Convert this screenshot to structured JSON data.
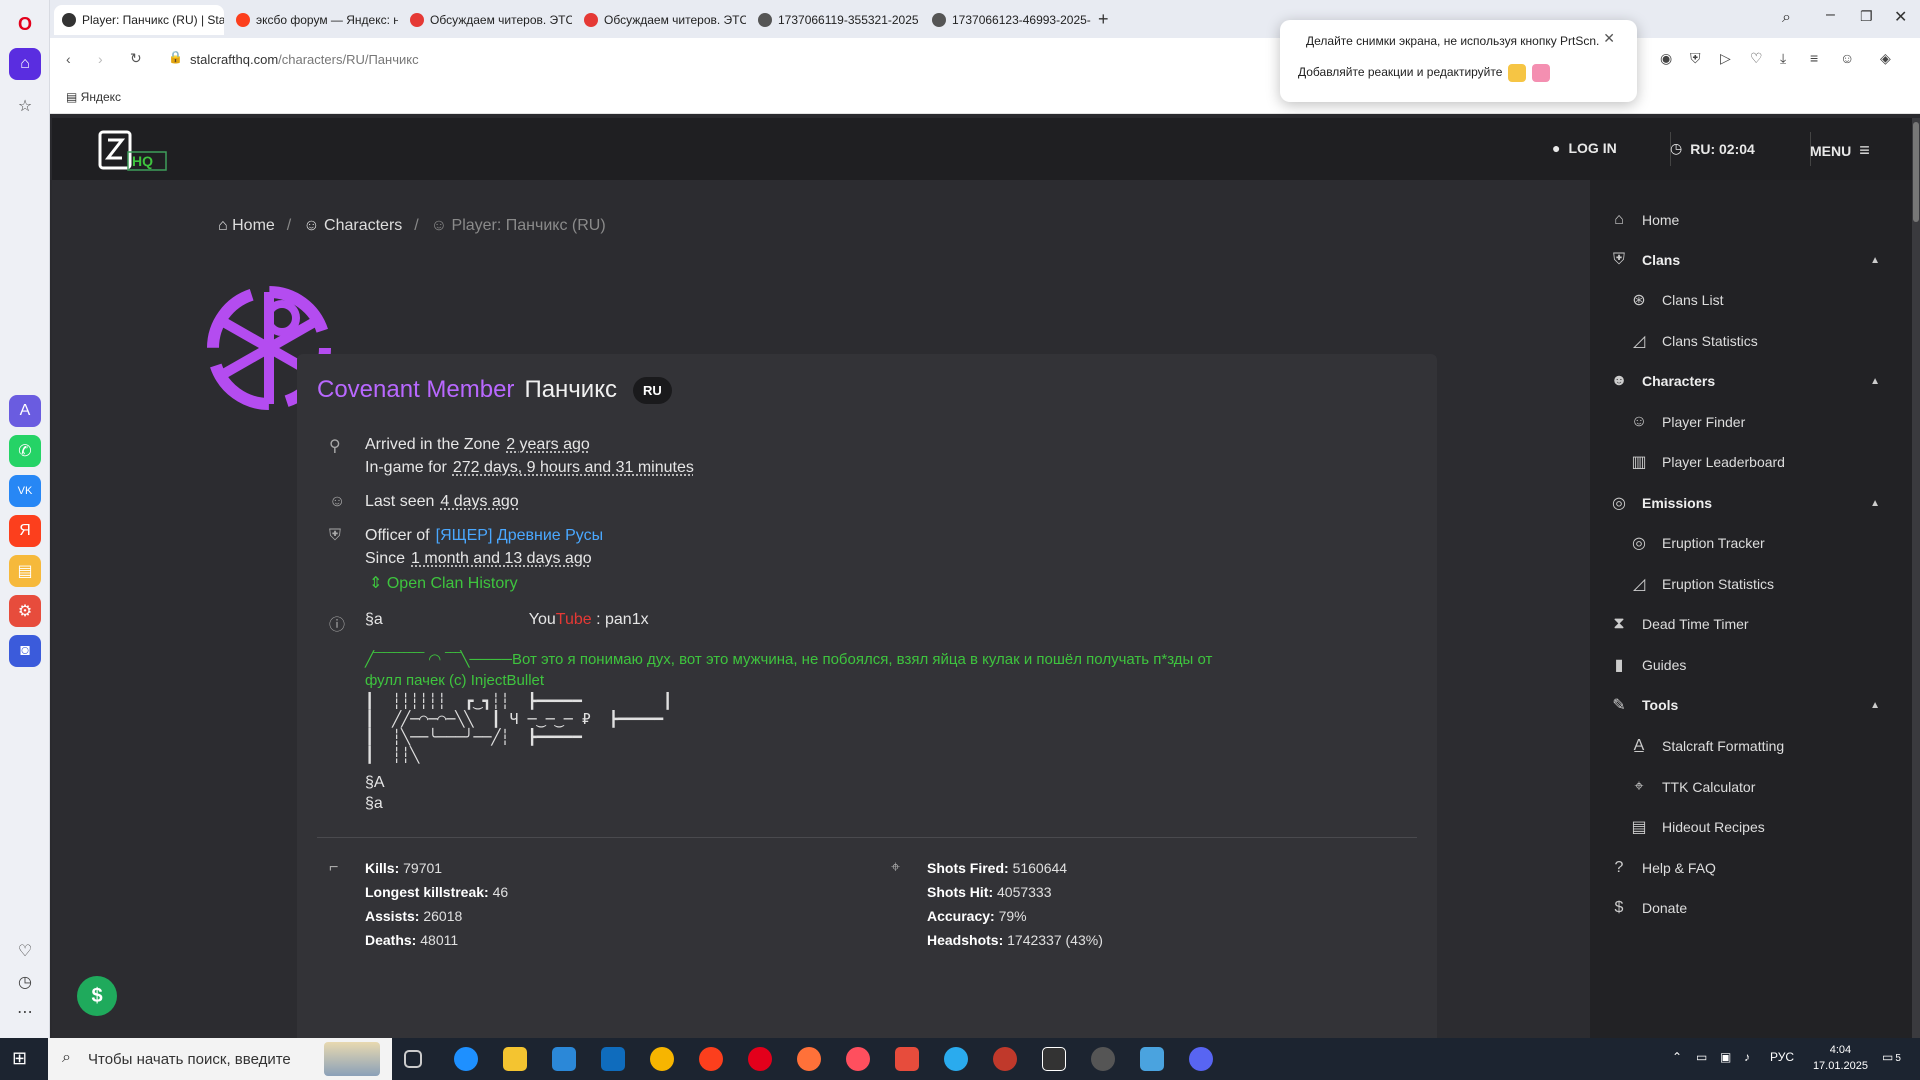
{
  "browser": {
    "tabs": [
      {
        "title": "Player: Панчикс (RU) | Sta",
        "color": "#333333"
      },
      {
        "title": "эксбо форум — Яндекс: н",
        "color": "#fc3f1d"
      },
      {
        "title": "Обсуждаем читеров. ЭТС",
        "color": "#e53935"
      },
      {
        "title": "Обсуждаем читеров. ЭТС",
        "color": "#e53935"
      },
      {
        "title": "1737066119-355321-2025",
        "color": "#555555"
      },
      {
        "title": "1737066123-46993-2025-",
        "color": "#555555"
      }
    ],
    "url_host": "stalcrafthq.com",
    "url_path": "/characters/RU/Панчикс",
    "bookmark": "Яндекс"
  },
  "popup": {
    "line1": "Делайте снимки экрана, не используя кнопку PrtScn.",
    "line2": "Добавляйте реакции и редактируйте"
  },
  "header": {
    "login": "LOG IN",
    "time": "RU: 02:04",
    "menu": "MENU"
  },
  "breadcrumb": {
    "home": "Home",
    "characters": "Characters",
    "current": "Player: Панчикс (RU)"
  },
  "player": {
    "rank": "Covenant Member",
    "name": "Панчикс",
    "region": "RU",
    "arrived_label": "Arrived in the Zone",
    "arrived_value": "2 years ago",
    "ingame_label": "In-game for",
    "ingame_value": "272 days, 9 hours and 31 minutes",
    "lastseen_label": "Last seen",
    "lastseen_value": "4 days ago",
    "officer_label": "Officer of",
    "clan": "[ЯЩЕР] Древние Русы",
    "since_label": "Since",
    "since_value": "1 month and 13 days ago",
    "clan_history": "Open Clan History",
    "bio_line1_a": "§a",
    "bio_line1_you": "You",
    "bio_line1_tube": "Tube",
    "bio_line1_rest": " : pan1x",
    "bio_quote": "Вот это я понимаю дух, вот это мужчина, не побоялся, взял яйца в кулак и пошёл получать п*зды от",
    "bio_quote2": "фулл пачек (с) InjectBullet",
    "bio_end1": "§A",
    "bio_end2": "§a"
  },
  "stats": {
    "kills_label": "Kills:",
    "kills": "79701",
    "streak_label": "Longest killstreak:",
    "streak": "46",
    "assists_label": "Assists:",
    "assists": "26018",
    "deaths_label": "Deaths:",
    "deaths": "48011",
    "fired_label": "Shots Fired:",
    "fired": "5160644",
    "hit_label": "Shots Hit:",
    "hit": "4057333",
    "accuracy_label": "Accuracy:",
    "accuracy": "79%",
    "headshots_label": "Headshots:",
    "headshots": "1742337 (43%)"
  },
  "sidebar": {
    "home": "Home",
    "clans": "Clans",
    "clans_list": "Clans List",
    "clans_stats": "Clans Statistics",
    "characters": "Characters",
    "player_finder": "Player Finder",
    "player_leaderboard": "Player Leaderboard",
    "emissions": "Emissions",
    "eruption_tracker": "Eruption Tracker",
    "eruption_stats": "Eruption Statistics",
    "dead_time": "Dead Time Timer",
    "guides": "Guides",
    "tools": "Tools",
    "formatting": "Stalcraft Formatting",
    "ttk": "TTK Calculator",
    "hideout": "Hideout Recipes",
    "help": "Help & FAQ",
    "donate": "Donate"
  },
  "taskbar": {
    "search": "Чтобы начать поиск, введите",
    "lang": "РУС",
    "time": "4:04",
    "date": "17.01.2025",
    "notif": "5"
  },
  "colors": {
    "accent_purple": "#b968ff",
    "link_blue": "#4aa8ff",
    "green": "#3ec43e"
  }
}
